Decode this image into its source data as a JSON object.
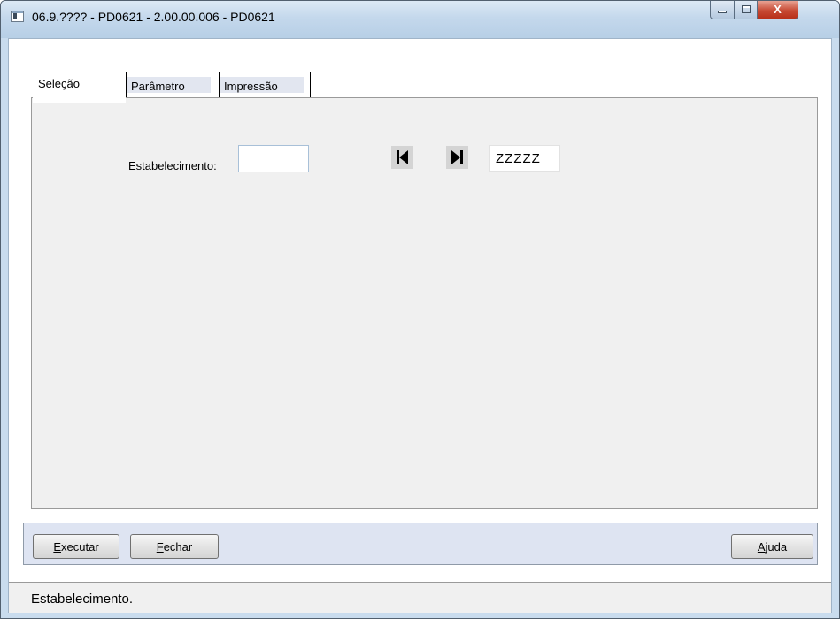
{
  "window": {
    "title": "06.9.???? - PD0621 - 2.00.00.006 - PD0621",
    "controls": {
      "close_symbol": "X"
    }
  },
  "tabs": [
    {
      "label": "Seleção",
      "selected": true
    },
    {
      "label": "Parâmetro",
      "selected": false
    },
    {
      "label": "Impressão",
      "selected": false
    }
  ],
  "selection": {
    "field_label": "Estabelecimento:",
    "start_value": "",
    "end_value": "ZZZZZ"
  },
  "buttons": {
    "execute": {
      "mnemonic": "E",
      "rest": "xecutar"
    },
    "close": {
      "mnemonic": "F",
      "rest": "echar"
    },
    "help": {
      "mnemonic": "A",
      "rest": "juda"
    }
  },
  "status": {
    "text": "Estabelecimento."
  },
  "colors": {
    "window_frame": "#c9dcee",
    "panel": "#f0f0f0",
    "button_bar": "#dee4f2",
    "close_button": "#c74a34"
  },
  "icons": [
    "app-icon",
    "minimize-icon",
    "maximize-icon",
    "close-icon",
    "first-record-icon",
    "last-record-icon"
  ]
}
